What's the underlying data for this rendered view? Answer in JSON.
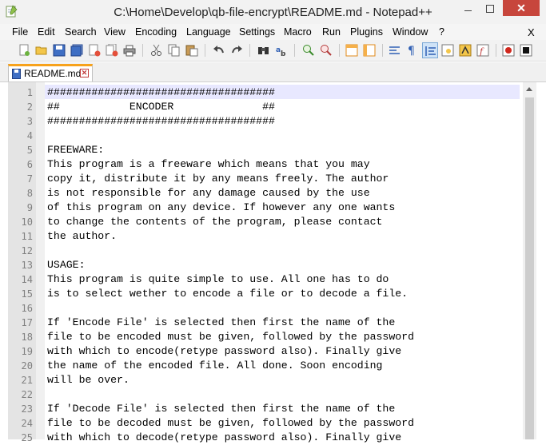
{
  "window": {
    "title": "C:\\Home\\Develop\\qb-file-encrypt\\README.md - Notepad++",
    "close_glyph": "✕"
  },
  "menu": {
    "items": [
      "File",
      "Edit",
      "Search",
      "View",
      "Encoding",
      "Language",
      "Settings",
      "Macro",
      "Run",
      "Plugins",
      "Window",
      "?"
    ],
    "close": "X"
  },
  "toolbar": {
    "icons": [
      "new-file-icon",
      "open-file-icon",
      "save-icon",
      "save-all-icon",
      "close-icon",
      "close-all-icon",
      "print-icon",
      "cut-icon",
      "copy-icon",
      "paste-icon",
      "undo-icon",
      "redo-icon",
      "find-icon",
      "replace-icon",
      "zoom-in-icon",
      "zoom-out-icon",
      "sync-vertical-icon",
      "sync-horizontal-icon",
      "word-wrap-icon",
      "show-all-chars-icon",
      "indent-guide-icon",
      "doc-map-icon",
      "function-list-icon",
      "macro-record-icon",
      "macro-stop-icon"
    ],
    "active_icon": "indent-guide-icon"
  },
  "tab": {
    "label": "README.md",
    "close_glyph": "✕"
  },
  "editor": {
    "lines": [
      "####################################",
      "##           ENCODER              ##",
      "####################################",
      "",
      "FREEWARE:",
      "This program is a freeware which means that you may",
      "copy it, distribute it by any means freely. The author",
      "is not responsible for any damage caused by the use",
      "of this program on any device. If however any one wants",
      "to change the contents of the program, please contact",
      "the author.",
      "",
      "USAGE:",
      "This program is quite simple to use. All one has to do",
      "is to select wether to encode a file or to decode a file.",
      "",
      "If 'Encode File' is selected then first the name of the",
      "file to be encoded must be given, followed by the password",
      "with which to encode(retype password also). Finally give",
      "the name of the encoded file. All done. Soon encoding",
      "will be over.",
      "",
      "If 'Decode File' is selected then first the name of the",
      "file to be decoded must be given, followed by the password",
      "with which to decode(retype password also). Finally give"
    ]
  }
}
